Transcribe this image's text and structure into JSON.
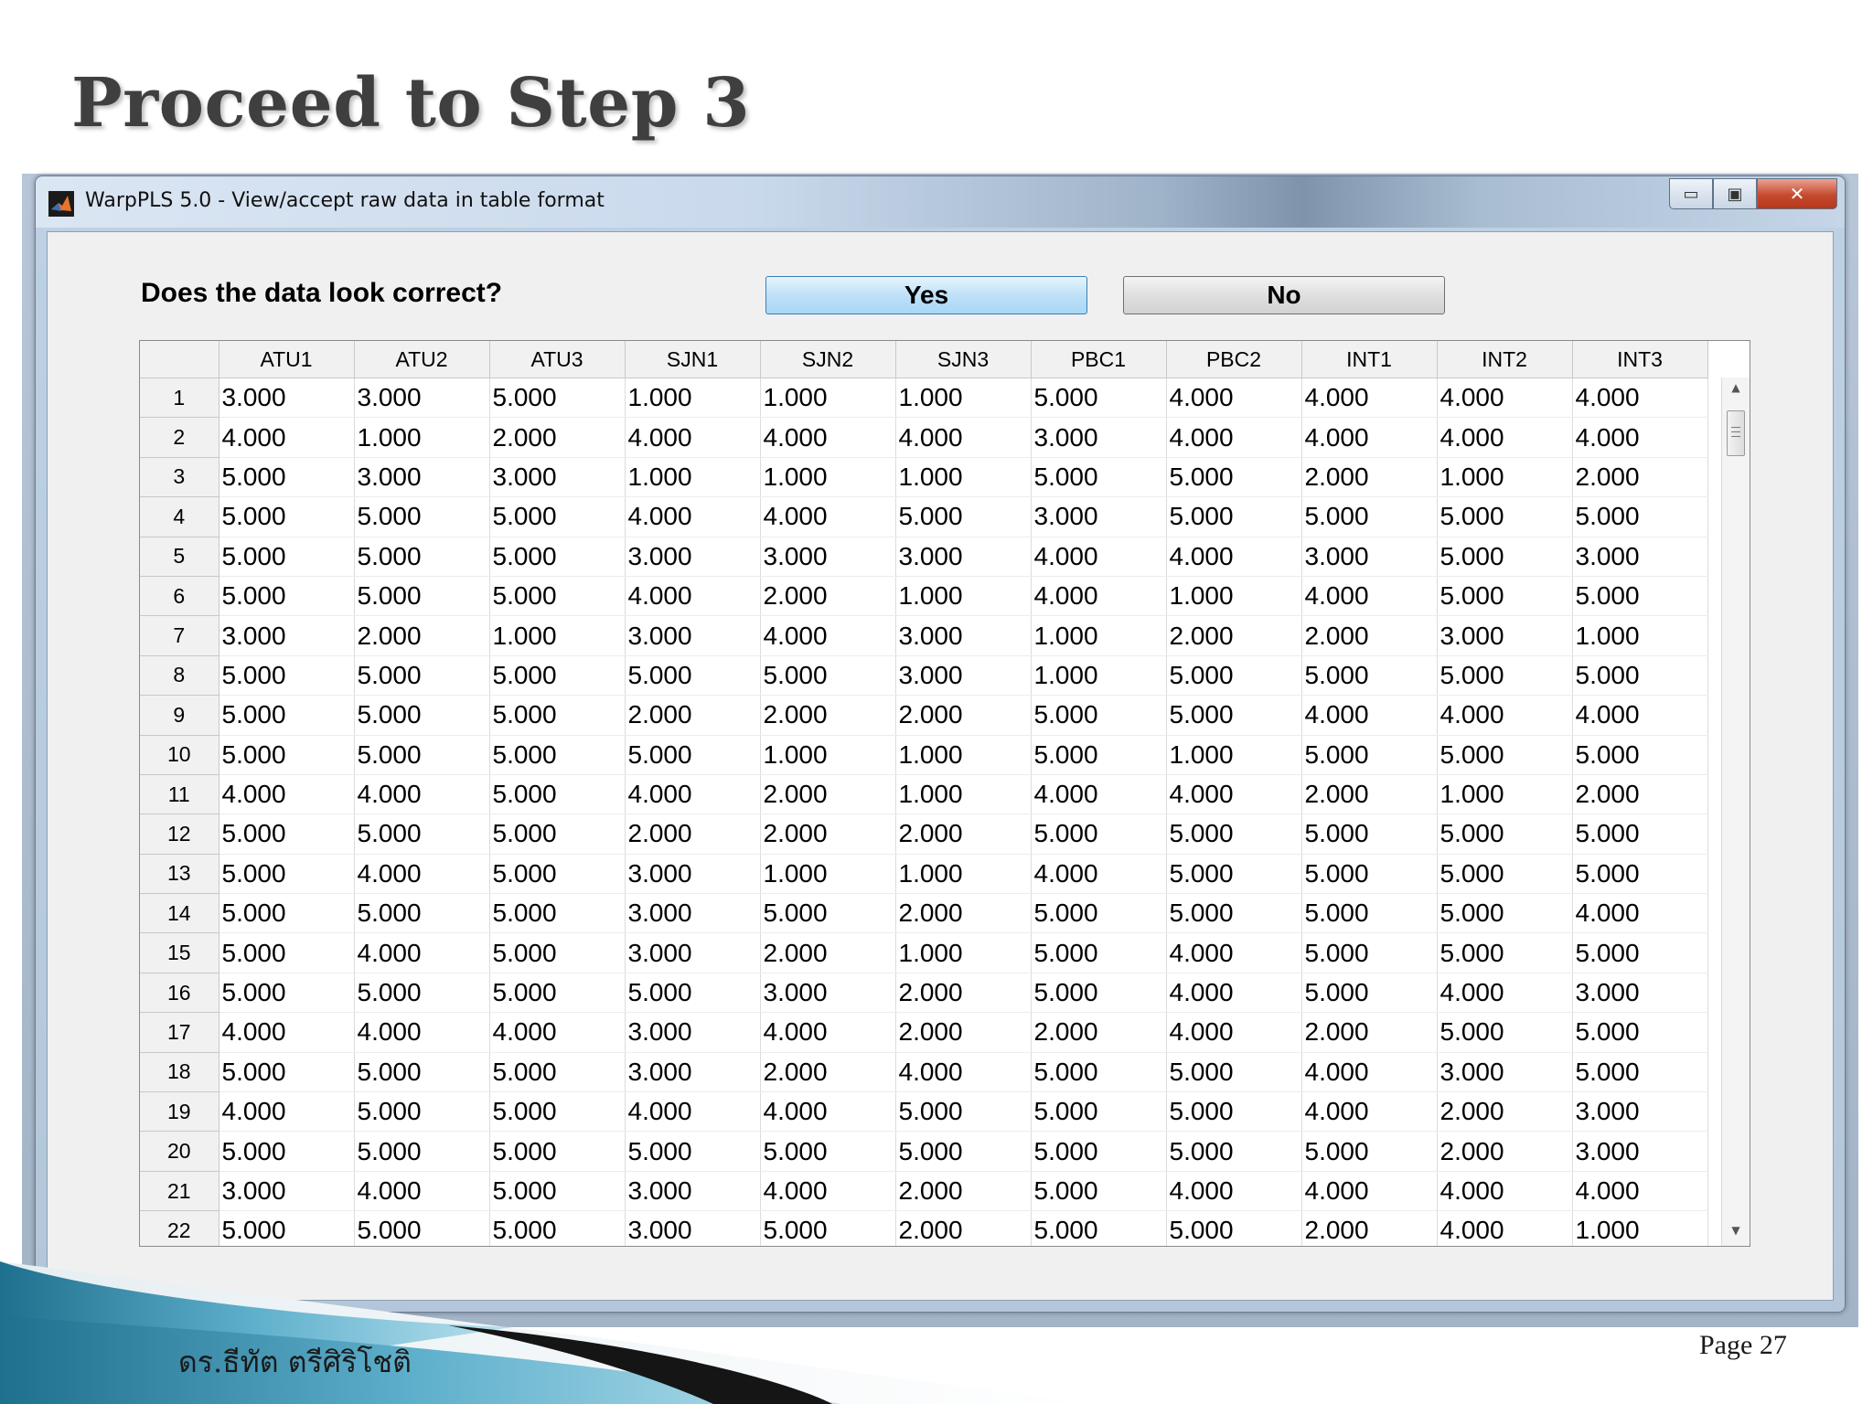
{
  "slide": {
    "title": "Proceed to Step 3",
    "footer_author": "ดร.ธีทัต ตรีศิริโชติ",
    "footer_page": "Page 27"
  },
  "window": {
    "title": "WarpPLS 5.0 - View/accept raw data in table format",
    "app_icon": "matlab-icon",
    "minimize_glyph": "▭",
    "maximize_glyph": "▣",
    "close_glyph": "✕"
  },
  "dialog": {
    "question": "Does the data look correct?",
    "yes_label": "Yes",
    "no_label": "No"
  },
  "table": {
    "columns": [
      "ATU1",
      "ATU2",
      "ATU3",
      "SJN1",
      "SJN2",
      "SJN3",
      "PBC1",
      "PBC2",
      "INT1",
      "INT2",
      "INT3"
    ],
    "rows": [
      {
        "n": "1",
        "cells": [
          "3.000",
          "3.000",
          "5.000",
          "1.000",
          "1.000",
          "1.000",
          "5.000",
          "4.000",
          "4.000",
          "4.000",
          "4.000"
        ]
      },
      {
        "n": "2",
        "cells": [
          "4.000",
          "1.000",
          "2.000",
          "4.000",
          "4.000",
          "4.000",
          "3.000",
          "4.000",
          "4.000",
          "4.000",
          "4.000"
        ]
      },
      {
        "n": "3",
        "cells": [
          "5.000",
          "3.000",
          "3.000",
          "1.000",
          "1.000",
          "1.000",
          "5.000",
          "5.000",
          "2.000",
          "1.000",
          "2.000"
        ]
      },
      {
        "n": "4",
        "cells": [
          "5.000",
          "5.000",
          "5.000",
          "4.000",
          "4.000",
          "5.000",
          "3.000",
          "5.000",
          "5.000",
          "5.000",
          "5.000"
        ]
      },
      {
        "n": "5",
        "cells": [
          "5.000",
          "5.000",
          "5.000",
          "3.000",
          "3.000",
          "3.000",
          "4.000",
          "4.000",
          "3.000",
          "5.000",
          "3.000"
        ]
      },
      {
        "n": "6",
        "cells": [
          "5.000",
          "5.000",
          "5.000",
          "4.000",
          "2.000",
          "1.000",
          "4.000",
          "1.000",
          "4.000",
          "5.000",
          "5.000"
        ]
      },
      {
        "n": "7",
        "cells": [
          "3.000",
          "2.000",
          "1.000",
          "3.000",
          "4.000",
          "3.000",
          "1.000",
          "2.000",
          "2.000",
          "3.000",
          "1.000"
        ]
      },
      {
        "n": "8",
        "cells": [
          "5.000",
          "5.000",
          "5.000",
          "5.000",
          "5.000",
          "3.000",
          "1.000",
          "5.000",
          "5.000",
          "5.000",
          "5.000"
        ]
      },
      {
        "n": "9",
        "cells": [
          "5.000",
          "5.000",
          "5.000",
          "2.000",
          "2.000",
          "2.000",
          "5.000",
          "5.000",
          "4.000",
          "4.000",
          "4.000"
        ]
      },
      {
        "n": "10",
        "cells": [
          "5.000",
          "5.000",
          "5.000",
          "5.000",
          "1.000",
          "1.000",
          "5.000",
          "1.000",
          "5.000",
          "5.000",
          "5.000"
        ]
      },
      {
        "n": "11",
        "cells": [
          "4.000",
          "4.000",
          "5.000",
          "4.000",
          "2.000",
          "1.000",
          "4.000",
          "4.000",
          "2.000",
          "1.000",
          "2.000"
        ]
      },
      {
        "n": "12",
        "cells": [
          "5.000",
          "5.000",
          "5.000",
          "2.000",
          "2.000",
          "2.000",
          "5.000",
          "5.000",
          "5.000",
          "5.000",
          "5.000"
        ]
      },
      {
        "n": "13",
        "cells": [
          "5.000",
          "4.000",
          "5.000",
          "3.000",
          "1.000",
          "1.000",
          "4.000",
          "5.000",
          "5.000",
          "5.000",
          "5.000"
        ]
      },
      {
        "n": "14",
        "cells": [
          "5.000",
          "5.000",
          "5.000",
          "3.000",
          "5.000",
          "2.000",
          "5.000",
          "5.000",
          "5.000",
          "5.000",
          "4.000"
        ]
      },
      {
        "n": "15",
        "cells": [
          "5.000",
          "4.000",
          "5.000",
          "3.000",
          "2.000",
          "1.000",
          "5.000",
          "4.000",
          "5.000",
          "5.000",
          "5.000"
        ]
      },
      {
        "n": "16",
        "cells": [
          "5.000",
          "5.000",
          "5.000",
          "5.000",
          "3.000",
          "2.000",
          "5.000",
          "4.000",
          "5.000",
          "4.000",
          "3.000"
        ]
      },
      {
        "n": "17",
        "cells": [
          "4.000",
          "4.000",
          "4.000",
          "3.000",
          "4.000",
          "2.000",
          "2.000",
          "4.000",
          "2.000",
          "5.000",
          "5.000"
        ]
      },
      {
        "n": "18",
        "cells": [
          "5.000",
          "5.000",
          "5.000",
          "3.000",
          "2.000",
          "4.000",
          "5.000",
          "5.000",
          "4.000",
          "3.000",
          "5.000"
        ]
      },
      {
        "n": "19",
        "cells": [
          "4.000",
          "5.000",
          "5.000",
          "4.000",
          "4.000",
          "5.000",
          "5.000",
          "5.000",
          "4.000",
          "2.000",
          "3.000"
        ]
      },
      {
        "n": "20",
        "cells": [
          "5.000",
          "5.000",
          "5.000",
          "5.000",
          "5.000",
          "5.000",
          "5.000",
          "5.000",
          "5.000",
          "2.000",
          "3.000"
        ]
      },
      {
        "n": "21",
        "cells": [
          "3.000",
          "4.000",
          "5.000",
          "3.000",
          "4.000",
          "2.000",
          "5.000",
          "4.000",
          "4.000",
          "4.000",
          "4.000"
        ]
      },
      {
        "n": "22",
        "cells": [
          "5.000",
          "5.000",
          "5.000",
          "3.000",
          "5.000",
          "2.000",
          "5.000",
          "5.000",
          "2.000",
          "4.000",
          "1.000"
        ]
      }
    ]
  },
  "scrollbar": {
    "up_icon": "▲",
    "down_icon": "▼"
  },
  "colors": {
    "title_gray": "#3f3f3f",
    "yes_button": "#bfe1f8",
    "close_button": "#c54a2f",
    "swoosh_teal": "#2f7f9f"
  }
}
